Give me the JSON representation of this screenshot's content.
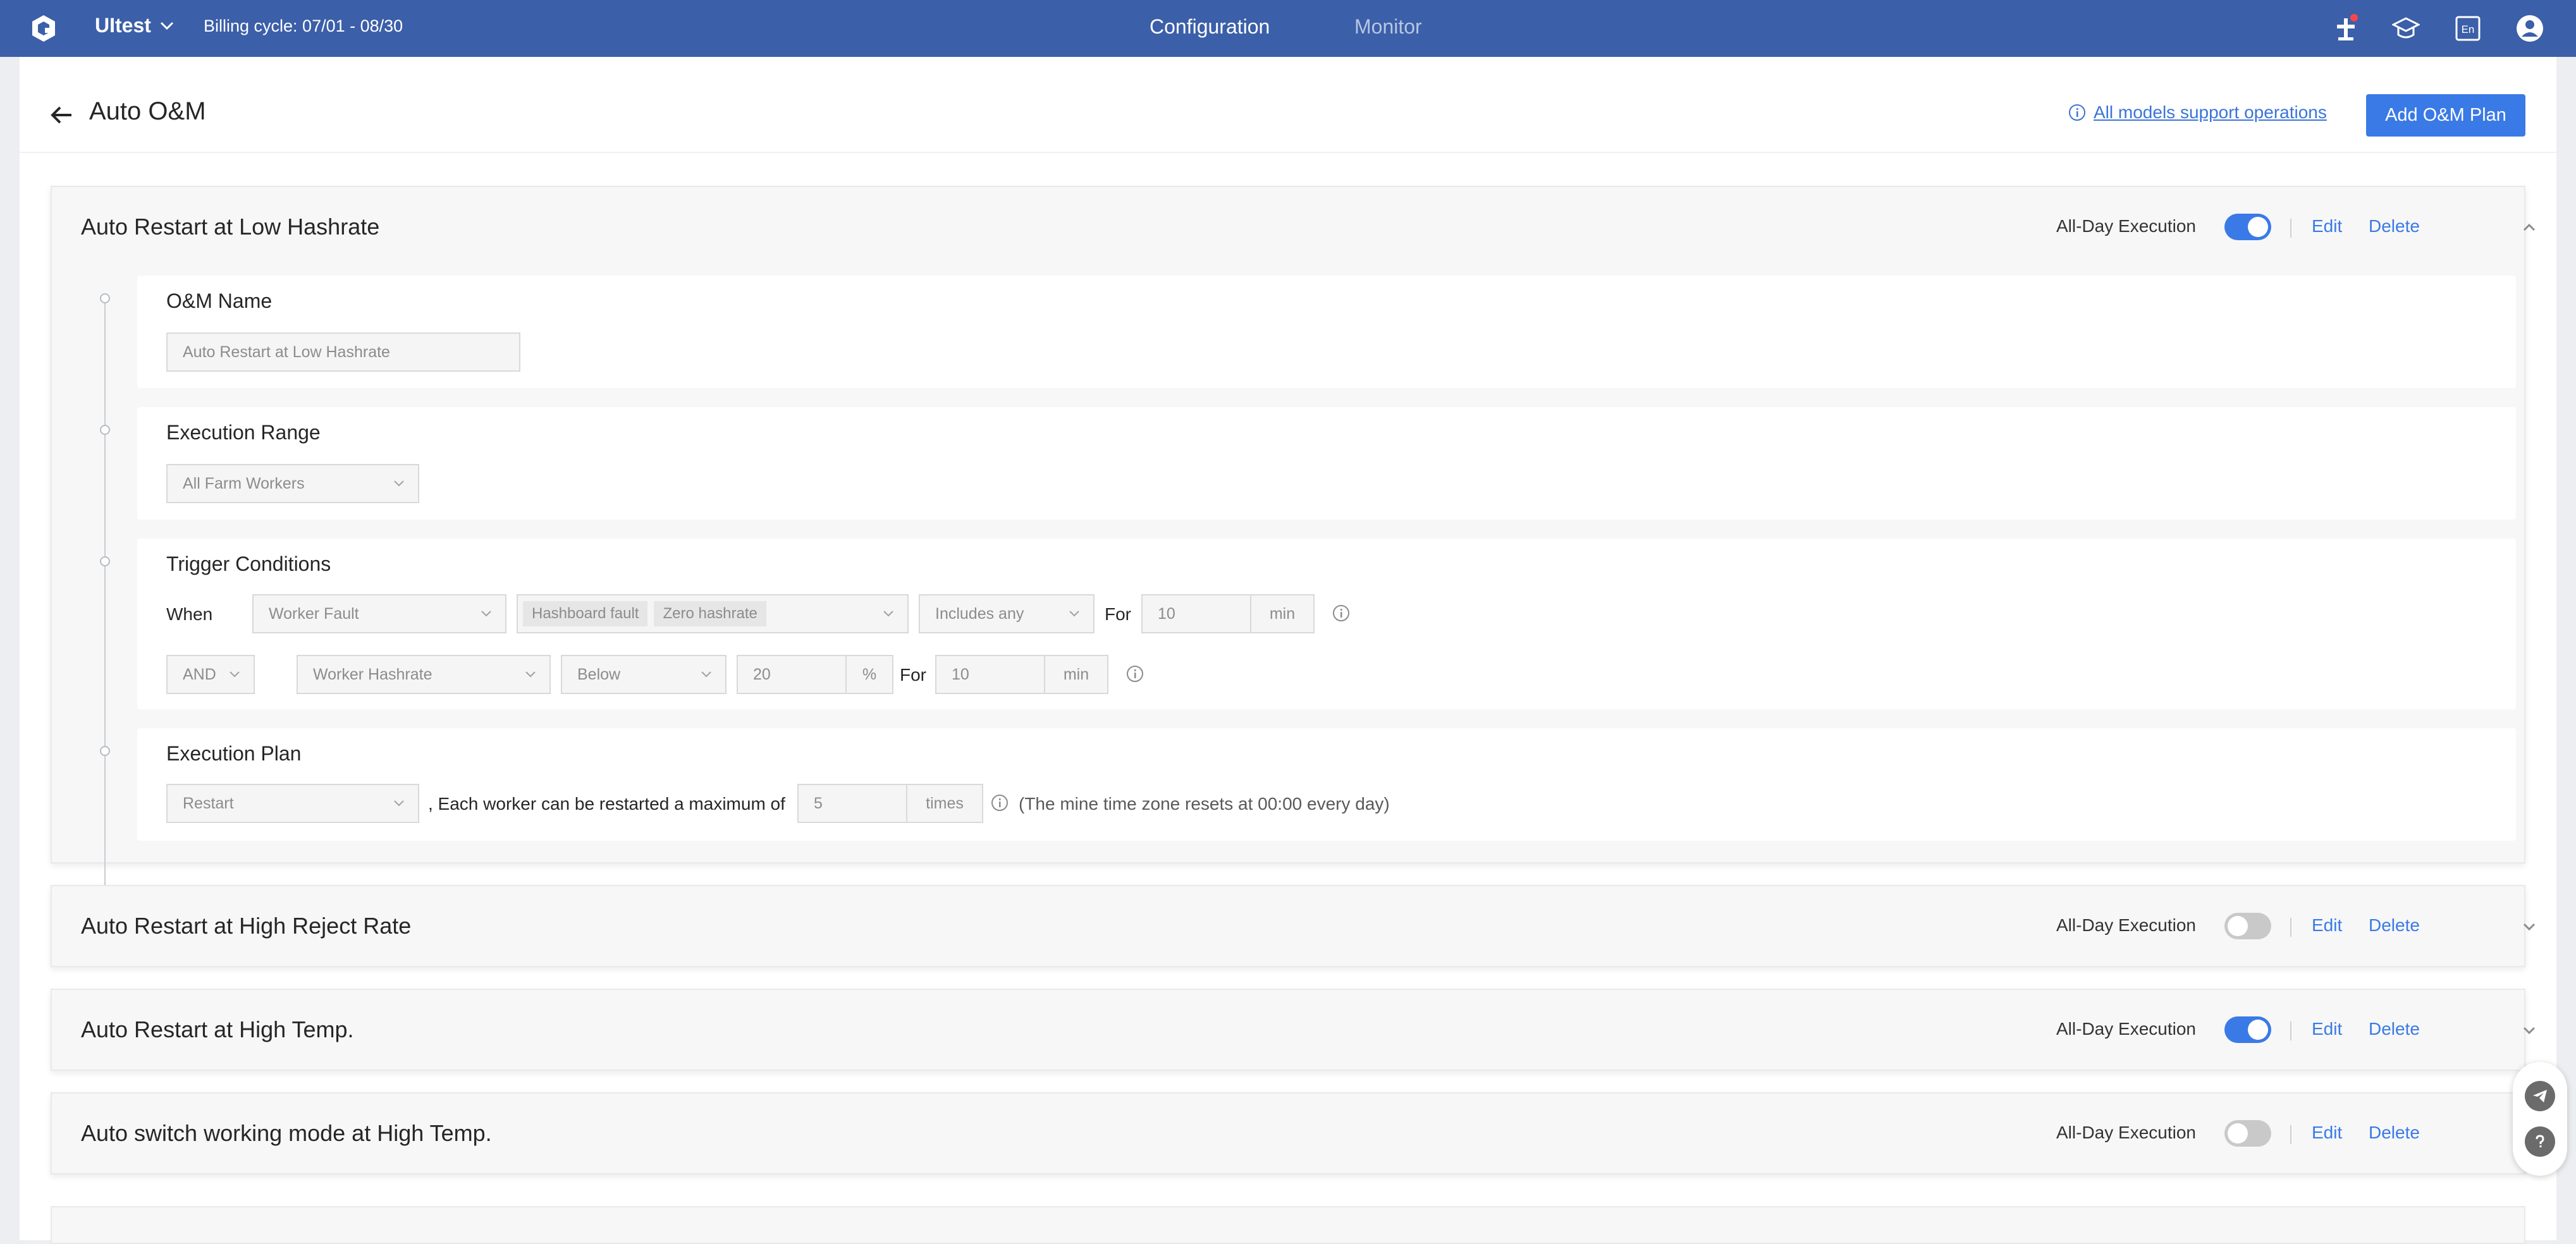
{
  "topbar": {
    "farm_name": "UItest",
    "billing_cycle": "Billing cycle: 07/01 - 08/30",
    "tabs": [
      {
        "label": "Configuration",
        "active": true
      },
      {
        "label": "Monitor",
        "active": false
      }
    ],
    "icons": [
      "user-add-icon",
      "academy-cap-icon",
      "language-en-icon",
      "account-icon"
    ],
    "lang_label": "En",
    "colors": {
      "bar": "#3b5fa8",
      "accent": "#3a7ae6"
    }
  },
  "page": {
    "title": "Auto O&M",
    "support_link": "All models support operations",
    "add_button": "Add O&M Plan"
  },
  "plans": [
    {
      "title": "Auto Restart at Low Hashrate",
      "all_day_label": "All-Day Execution",
      "all_day_on": true,
      "edit": "Edit",
      "delete": "Delete",
      "expanded": true
    },
    {
      "title": "Auto Restart at High Reject Rate",
      "all_day_label": "All-Day Execution",
      "all_day_on": false,
      "edit": "Edit",
      "delete": "Delete",
      "expanded": false
    },
    {
      "title": "Auto Restart at High Temp.",
      "all_day_label": "All-Day Execution",
      "all_day_on": true,
      "edit": "Edit",
      "delete": "Delete",
      "expanded": false
    },
    {
      "title": "Auto switch working mode at High Temp.",
      "all_day_label": "All-Day Execution",
      "all_day_on": false,
      "edit": "Edit",
      "delete": "Delete",
      "expanded": false
    }
  ],
  "detail": {
    "name_section": {
      "title": "O&M Name",
      "value": "Auto Restart at Low Hashrate"
    },
    "range_section": {
      "title": "Execution Range",
      "value": "All Farm Workers"
    },
    "trigger_section": {
      "title": "Trigger Conditions",
      "row1": {
        "when": "When",
        "metric": "Worker Fault",
        "tags": [
          "Hashboard fault",
          "Zero hashrate"
        ],
        "operator": "Includes any",
        "for": "For",
        "duration": "10",
        "unit": "min"
      },
      "row2": {
        "logic": "AND",
        "metric": "Worker Hashrate",
        "operator": "Below",
        "threshold": "20",
        "threshold_unit": "%",
        "for": "For",
        "duration": "10",
        "unit": "min"
      }
    },
    "plan_section": {
      "title": "Execution Plan",
      "action": "Restart",
      "text": ", Each worker can be restarted a maximum of",
      "max": "5",
      "max_unit": "times",
      "note": "(The mine time zone resets at 00:00 every day)"
    }
  }
}
